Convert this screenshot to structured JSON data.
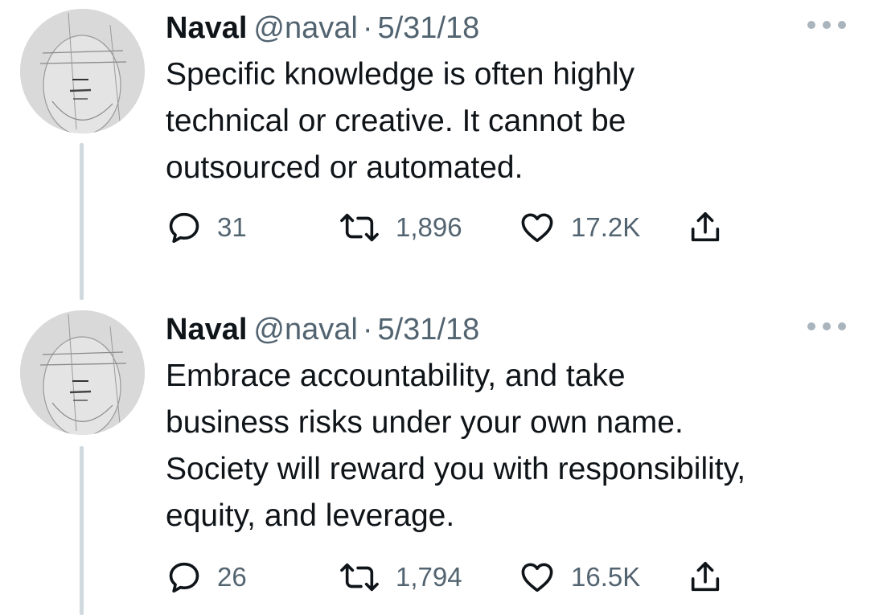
{
  "tweets": [
    {
      "display_name": "Naval",
      "handle": "@naval",
      "separator": "·",
      "date": "5/31/18",
      "text_lines": [
        "Specific knowledge is often highly",
        "technical or creative. It cannot be",
        "outsourced or automated."
      ],
      "replies": "31",
      "retweets": "1,896",
      "likes": "17.2K",
      "icons": [
        "reply-icon",
        "retweet-icon",
        "heart-icon",
        "share-icon",
        "more-icon"
      ]
    },
    {
      "display_name": "Naval",
      "handle": "@naval",
      "separator": "·",
      "date": "5/31/18",
      "text_lines": [
        "Embrace accountability, and take",
        "business risks under your own name.",
        "Society will reward you with responsibility,",
        "equity, and leverage."
      ],
      "replies": "26",
      "retweets": "1,794",
      "likes": "16.5K",
      "icons": [
        "reply-icon",
        "retweet-icon",
        "heart-icon",
        "share-icon",
        "more-icon"
      ]
    }
  ],
  "colors": {
    "text": "#0f1419",
    "secondary": "#536471",
    "thread_line": "#cfd9de",
    "background": "#ffffff"
  }
}
